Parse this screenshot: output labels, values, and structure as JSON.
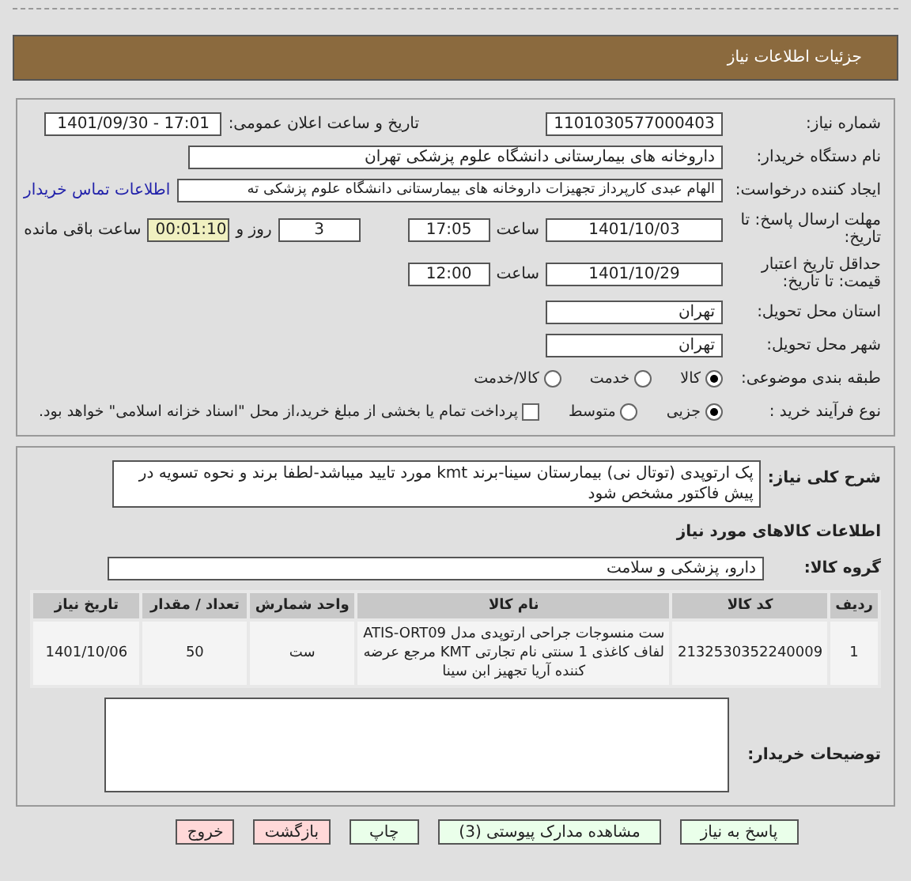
{
  "page_title": "جزئیات اطلاعات نیاز",
  "need_number": {
    "label": "شماره نیاز:",
    "value": "1101030577000403"
  },
  "announce_datetime": {
    "label": "تاریخ و ساعت اعلان عمومی:",
    "value": "1401/09/30 - 17:01"
  },
  "buyer_org": {
    "label": "نام دستگاه خریدار:",
    "value": "داروخانه های بیمارستانی دانشگاه علوم پزشکی تهران"
  },
  "requester": {
    "label": "ایجاد کننده درخواست:",
    "value": "الهام عبدی کارپرداز تجهیزات داروخانه های بیمارستانی دانشگاه علوم پزشکی ته",
    "contact_link": "اطلاعات تماس خریدار"
  },
  "reply_deadline": {
    "label": "مهلت ارسال پاسخ: تا تاریخ:",
    "date": "1401/10/03",
    "time_label": "ساعت",
    "time": "17:05",
    "days": "3",
    "days_label": "روز و",
    "remaining": "00:01:10",
    "remaining_label": "ساعت باقی مانده"
  },
  "price_validity": {
    "label": "حداقل تاریخ اعتبار قیمت: تا تاریخ:",
    "date": "1401/10/29",
    "time_label": "ساعت",
    "time": "12:00"
  },
  "delivery_province": {
    "label": "استان محل تحویل:",
    "value": "تهران"
  },
  "delivery_city": {
    "label": "شهر محل تحویل:",
    "value": "تهران"
  },
  "category": {
    "label": "طبقه بندی موضوعی:",
    "options": [
      {
        "label": "کالا",
        "selected": true
      },
      {
        "label": "خدمت",
        "selected": false
      },
      {
        "label": "کالا/خدمت",
        "selected": false
      }
    ]
  },
  "purchase_process": {
    "label": "نوع فرآیند خرید :",
    "options": [
      {
        "label": "جزیی",
        "selected": true
      },
      {
        "label": "متوسط",
        "selected": false
      }
    ],
    "treasury": {
      "label": "پرداخت تمام یا بخشی از مبلغ خرید،از محل \"اسناد خزانه اسلامی\" خواهد بود.",
      "checked": false
    }
  },
  "description": {
    "label": "شرح کلی نیاز:",
    "value": "پک ارتوپدی (توتال نی) بیمارستان سینا-برند kmt مورد تایید میباشد-لطفا برند و نحوه تسویه در پیش فاکتور مشخص شود"
  },
  "goods_title": "اطلاعات کالاهای مورد نیاز",
  "goods_group": {
    "label": "گروه کالا:",
    "value": "دارو، پزشکی و سلامت"
  },
  "table": {
    "columns": [
      "ردیف",
      "کد کالا",
      "نام کالا",
      "واحد شمارش",
      "تعداد / مقدار",
      "تاریخ نیاز"
    ],
    "rows": [
      [
        "1",
        "2132530352240009",
        "ست منسوجات جراحی ارتوپدی مدل ATIS-ORT09 لفاف کاغذی 1 سنتی نام تجارتی KMT مرجع عرضه کننده آریا تجهیز ابن سینا",
        "ست",
        "50",
        "1401/10/06"
      ]
    ]
  },
  "buyer_notes": {
    "label": "توضیحات خریدار:"
  },
  "buttons": [
    {
      "label": "پاسخ به نیاز",
      "kind": "confirm"
    },
    {
      "label": "مشاهده مدارک پیوستی (3)",
      "kind": "confirm"
    },
    {
      "label": "چاپ",
      "kind": "confirm"
    },
    {
      "label": "بازگشت",
      "kind": "cancel"
    },
    {
      "label": "خروج",
      "kind": "cancel"
    }
  ]
}
